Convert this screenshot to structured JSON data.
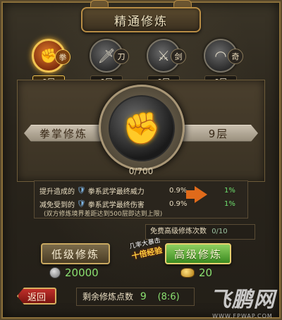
{
  "header": {
    "title": "精通修炼"
  },
  "tabs": [
    {
      "badge": "拳",
      "level": "9层",
      "icon": "fist-icon",
      "active": true
    },
    {
      "badge": "刀",
      "level": "0层",
      "icon": "blade-icon",
      "active": false
    },
    {
      "badge": "剑",
      "level": "0层",
      "icon": "sword-icon",
      "active": false
    },
    {
      "badge": "奇",
      "level": "0层",
      "icon": "fan-icon",
      "active": false
    }
  ],
  "skill": {
    "name": "拳掌修炼",
    "level": "9层",
    "progress_text": "0/700"
  },
  "stats": {
    "row1": {
      "prefix": "提升造成的",
      "name": "拳系武学最终威力",
      "current": "0.9%",
      "next": "1%"
    },
    "row2": {
      "prefix": "减免受到的",
      "name": "拳系武学最终伤害",
      "current": "0.9%",
      "next": "1%"
    },
    "note": "(双方修炼境界差距达到500层即达到上限)"
  },
  "free": {
    "label": "免费高级修炼次数",
    "count": "0/10"
  },
  "buttons": {
    "low": "低级修炼",
    "high": "高级修炼",
    "back": "返回"
  },
  "promo": {
    "line1": "几率大暴击",
    "line2": "十倍经验"
  },
  "costs": {
    "low": "20000",
    "high": "20"
  },
  "remain": {
    "label": "剩余修炼点数",
    "points": "9",
    "ratio": "(8:6)"
  },
  "watermark": {
    "logo": "飞鹏网",
    "url": "WWW.FPWAP.COM"
  },
  "colors": {
    "accent_gold": "#f1c451",
    "green_value": "#8ae070",
    "arrow": "#e06a1a"
  }
}
